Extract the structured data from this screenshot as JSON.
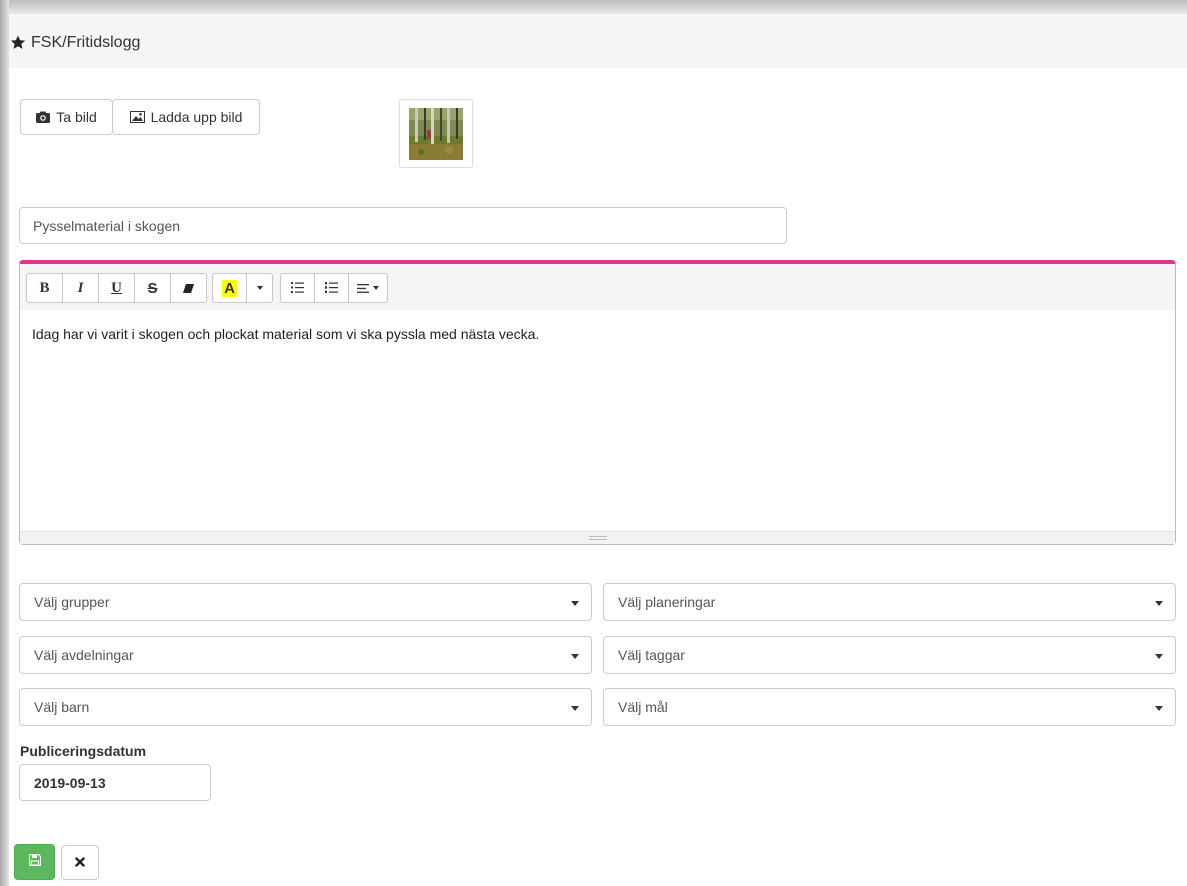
{
  "header": {
    "title": "FSK/Fritidslogg"
  },
  "image_buttons": {
    "take_photo": "Ta bild",
    "upload_photo": "Ladda upp bild"
  },
  "title_input": {
    "value": "Pysselmaterial i skogen"
  },
  "editor": {
    "toolbar": {
      "bold": "B",
      "italic": "I",
      "underline": "U",
      "strikethrough": "S",
      "highlight": "A"
    },
    "content": "Idag har vi varit i skogen och plockat material som vi ska pyssla med nästa vecka."
  },
  "selects": {
    "groups": "Välj grupper",
    "plans": "Välj planeringar",
    "departments": "Välj avdelningar",
    "tags": "Välj taggar",
    "children": "Välj barn",
    "goals": "Välj mål"
  },
  "publish": {
    "label": "Publiceringsdatum",
    "date": "2019-09-13"
  },
  "colors": {
    "accent": "#e0358f",
    "save": "#5cb85c",
    "highlight": "#ffff00"
  },
  "icons": [
    "star-icon",
    "camera-icon",
    "image-icon",
    "eraser-icon",
    "bullet-list-icon",
    "numbered-list-icon",
    "align-icon",
    "save-icon",
    "close-icon"
  ]
}
